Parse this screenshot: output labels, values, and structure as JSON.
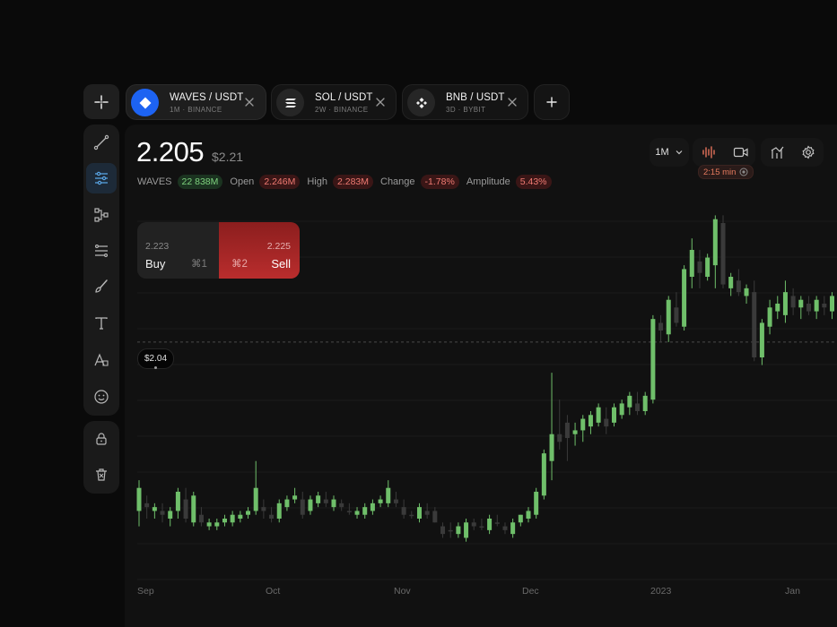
{
  "tabs": [
    {
      "pair": "WAVES / USDT",
      "meta": "1M · BINANCE",
      "active": true,
      "icon": "waves-diamond-icon"
    },
    {
      "pair": "SOL / USDT",
      "meta": "2W · BINANCE",
      "active": false,
      "icon": "solana-icon"
    },
    {
      "pair": "BNB / USDT",
      "meta": "3D · BYBIT",
      "active": false,
      "icon": "bnb-icon"
    }
  ],
  "header": {
    "price": "2.205",
    "price_usd": "$2.21"
  },
  "stats": {
    "symbol": "WAVES",
    "volume": "22 838M",
    "open_label": "Open",
    "open": "2.246M",
    "high_label": "High",
    "high": "2.283M",
    "change_label": "Change",
    "change": "-1.78%",
    "amplitude_label": "Amplitude",
    "amplitude": "5.43%"
  },
  "controls": {
    "timeframe": "1M",
    "recording_time": "2:15 min"
  },
  "trade": {
    "buy_price": "2.223",
    "buy_label": "Buy",
    "buy_shortcut": "⌘1",
    "sell_price": "2.225",
    "sell_label": "Sell",
    "sell_shortcut": "⌘2"
  },
  "price_tag": "$2.04",
  "colors": {
    "up": "#6fbf6a",
    "down": "#3a3a3a",
    "accent": "#1d63f2",
    "sell": "#b92d2d"
  },
  "chart_data": {
    "type": "candlestick",
    "x_labels": [
      "Sep",
      "Oct",
      "Nov",
      "Dec",
      "2023",
      "Jan"
    ],
    "candles": [
      {
        "o": 1.6,
        "h": 1.68,
        "l": 1.56,
        "c": 1.66,
        "up": true
      },
      {
        "o": 1.61,
        "h": 1.64,
        "l": 1.58,
        "c": 1.62,
        "up": false
      },
      {
        "o": 1.6,
        "h": 1.62,
        "l": 1.58,
        "c": 1.61,
        "up": true
      },
      {
        "o": 1.6,
        "h": 1.62,
        "l": 1.57,
        "c": 1.59,
        "up": false
      },
      {
        "o": 1.58,
        "h": 1.61,
        "l": 1.56,
        "c": 1.6,
        "up": true
      },
      {
        "o": 1.6,
        "h": 1.66,
        "l": 1.58,
        "c": 1.65,
        "up": true
      },
      {
        "o": 1.63,
        "h": 1.66,
        "l": 1.57,
        "c": 1.58,
        "up": false
      },
      {
        "o": 1.57,
        "h": 1.65,
        "l": 1.56,
        "c": 1.64,
        "up": true
      },
      {
        "o": 1.59,
        "h": 1.61,
        "l": 1.56,
        "c": 1.57,
        "up": false
      },
      {
        "o": 1.56,
        "h": 1.58,
        "l": 1.55,
        "c": 1.57,
        "up": true
      },
      {
        "o": 1.56,
        "h": 1.58,
        "l": 1.55,
        "c": 1.57,
        "up": true
      },
      {
        "o": 1.57,
        "h": 1.59,
        "l": 1.56,
        "c": 1.58,
        "up": true
      },
      {
        "o": 1.57,
        "h": 1.6,
        "l": 1.56,
        "c": 1.59,
        "up": true
      },
      {
        "o": 1.58,
        "h": 1.6,
        "l": 1.57,
        "c": 1.59,
        "up": true
      },
      {
        "o": 1.59,
        "h": 1.61,
        "l": 1.58,
        "c": 1.6,
        "up": true
      },
      {
        "o": 1.6,
        "h": 1.73,
        "l": 1.59,
        "c": 1.66,
        "up": true
      },
      {
        "o": 1.61,
        "h": 1.63,
        "l": 1.58,
        "c": 1.6,
        "up": false
      },
      {
        "o": 1.59,
        "h": 1.61,
        "l": 1.57,
        "c": 1.58,
        "up": false
      },
      {
        "o": 1.58,
        "h": 1.63,
        "l": 1.57,
        "c": 1.62,
        "up": true
      },
      {
        "o": 1.61,
        "h": 1.64,
        "l": 1.6,
        "c": 1.63,
        "up": true
      },
      {
        "o": 1.63,
        "h": 1.66,
        "l": 1.62,
        "c": 1.64,
        "up": true
      },
      {
        "o": 1.63,
        "h": 1.65,
        "l": 1.58,
        "c": 1.59,
        "up": false
      },
      {
        "o": 1.6,
        "h": 1.64,
        "l": 1.59,
        "c": 1.63,
        "up": true
      },
      {
        "o": 1.62,
        "h": 1.65,
        "l": 1.61,
        "c": 1.64,
        "up": true
      },
      {
        "o": 1.63,
        "h": 1.65,
        "l": 1.61,
        "c": 1.62,
        "up": false
      },
      {
        "o": 1.61,
        "h": 1.64,
        "l": 1.6,
        "c": 1.63,
        "up": true
      },
      {
        "o": 1.62,
        "h": 1.63,
        "l": 1.6,
        "c": 1.61,
        "up": false
      },
      {
        "o": 1.6,
        "h": 1.62,
        "l": 1.59,
        "c": 1.6,
        "up": false
      },
      {
        "o": 1.59,
        "h": 1.61,
        "l": 1.58,
        "c": 1.6,
        "up": true
      },
      {
        "o": 1.59,
        "h": 1.62,
        "l": 1.58,
        "c": 1.61,
        "up": true
      },
      {
        "o": 1.6,
        "h": 1.63,
        "l": 1.59,
        "c": 1.62,
        "up": true
      },
      {
        "o": 1.62,
        "h": 1.64,
        "l": 1.61,
        "c": 1.63,
        "up": true
      },
      {
        "o": 1.62,
        "h": 1.68,
        "l": 1.61,
        "c": 1.66,
        "up": true
      },
      {
        "o": 1.63,
        "h": 1.65,
        "l": 1.61,
        "c": 1.62,
        "up": false
      },
      {
        "o": 1.61,
        "h": 1.63,
        "l": 1.58,
        "c": 1.59,
        "up": false
      },
      {
        "o": 1.59,
        "h": 1.6,
        "l": 1.58,
        "c": 1.59,
        "up": false
      },
      {
        "o": 1.58,
        "h": 1.62,
        "l": 1.57,
        "c": 1.61,
        "up": true
      },
      {
        "o": 1.6,
        "h": 1.62,
        "l": 1.58,
        "c": 1.59,
        "up": false
      },
      {
        "o": 1.6,
        "h": 1.61,
        "l": 1.57,
        "c": 1.57,
        "up": false
      },
      {
        "o": 1.56,
        "h": 1.57,
        "l": 1.53,
        "c": 1.54,
        "up": false
      },
      {
        "o": 1.55,
        "h": 1.57,
        "l": 1.53,
        "c": 1.55,
        "up": false
      },
      {
        "o": 1.54,
        "h": 1.57,
        "l": 1.53,
        "c": 1.56,
        "up": true
      },
      {
        "o": 1.53,
        "h": 1.58,
        "l": 1.52,
        "c": 1.57,
        "up": true
      },
      {
        "o": 1.56,
        "h": 1.58,
        "l": 1.55,
        "c": 1.57,
        "up": false
      },
      {
        "o": 1.56,
        "h": 1.58,
        "l": 1.55,
        "c": 1.56,
        "up": false
      },
      {
        "o": 1.55,
        "h": 1.59,
        "l": 1.54,
        "c": 1.58,
        "up": true
      },
      {
        "o": 1.57,
        "h": 1.59,
        "l": 1.56,
        "c": 1.57,
        "up": false
      },
      {
        "o": 1.56,
        "h": 1.57,
        "l": 1.54,
        "c": 1.55,
        "up": false
      },
      {
        "o": 1.54,
        "h": 1.58,
        "l": 1.53,
        "c": 1.57,
        "up": true
      },
      {
        "o": 1.57,
        "h": 1.59,
        "l": 1.56,
        "c": 1.59,
        "up": true
      },
      {
        "o": 1.58,
        "h": 1.61,
        "l": 1.57,
        "c": 1.6,
        "up": true
      },
      {
        "o": 1.59,
        "h": 1.66,
        "l": 1.58,
        "c": 1.65,
        "up": true
      },
      {
        "o": 1.64,
        "h": 1.76,
        "l": 1.63,
        "c": 1.75,
        "up": true
      },
      {
        "o": 1.73,
        "h": 1.96,
        "l": 1.68,
        "c": 1.8,
        "up": true
      },
      {
        "o": 1.78,
        "h": 1.89,
        "l": 1.76,
        "c": 1.8,
        "up": false
      },
      {
        "o": 1.79,
        "h": 1.85,
        "l": 1.73,
        "c": 1.83,
        "up": false
      },
      {
        "o": 1.8,
        "h": 1.83,
        "l": 1.77,
        "c": 1.81,
        "up": true
      },
      {
        "o": 1.81,
        "h": 1.85,
        "l": 1.78,
        "c": 1.84,
        "up": true
      },
      {
        "o": 1.82,
        "h": 1.86,
        "l": 1.8,
        "c": 1.85,
        "up": true
      },
      {
        "o": 1.83,
        "h": 1.88,
        "l": 1.82,
        "c": 1.87,
        "up": true
      },
      {
        "o": 1.84,
        "h": 1.87,
        "l": 1.8,
        "c": 1.82,
        "up": false
      },
      {
        "o": 1.83,
        "h": 1.88,
        "l": 1.82,
        "c": 1.87,
        "up": true
      },
      {
        "o": 1.85,
        "h": 1.89,
        "l": 1.84,
        "c": 1.88,
        "up": true
      },
      {
        "o": 1.87,
        "h": 1.91,
        "l": 1.85,
        "c": 1.9,
        "up": true
      },
      {
        "o": 1.88,
        "h": 1.91,
        "l": 1.85,
        "c": 1.86,
        "up": false
      },
      {
        "o": 1.86,
        "h": 1.91,
        "l": 1.85,
        "c": 1.9,
        "up": true
      },
      {
        "o": 1.89,
        "h": 2.11,
        "l": 1.88,
        "c": 2.1,
        "up": true
      },
      {
        "o": 2.09,
        "h": 2.11,
        "l": 2.04,
        "c": 2.07,
        "up": false
      },
      {
        "o": 2.06,
        "h": 2.16,
        "l": 2.04,
        "c": 2.15,
        "up": true
      },
      {
        "o": 2.13,
        "h": 2.17,
        "l": 2.08,
        "c": 2.09,
        "up": false
      },
      {
        "o": 2.08,
        "h": 2.24,
        "l": 2.07,
        "c": 2.23,
        "up": true
      },
      {
        "o": 2.21,
        "h": 2.31,
        "l": 2.18,
        "c": 2.28,
        "up": true
      },
      {
        "o": 2.25,
        "h": 2.28,
        "l": 2.18,
        "c": 2.22,
        "up": false
      },
      {
        "o": 2.21,
        "h": 2.27,
        "l": 2.2,
        "c": 2.26,
        "up": true
      },
      {
        "o": 2.24,
        "h": 2.37,
        "l": 2.18,
        "c": 2.36,
        "up": true
      },
      {
        "o": 2.35,
        "h": 2.37,
        "l": 2.18,
        "c": 2.19,
        "up": false
      },
      {
        "o": 2.18,
        "h": 2.22,
        "l": 2.16,
        "c": 2.21,
        "up": true
      },
      {
        "o": 2.2,
        "h": 2.23,
        "l": 2.16,
        "c": 2.17,
        "up": false
      },
      {
        "o": 2.16,
        "h": 2.19,
        "l": 2.14,
        "c": 2.18,
        "up": true
      },
      {
        "o": 2.17,
        "h": 2.2,
        "l": 1.99,
        "c": 2.0,
        "up": false
      },
      {
        "o": 2.0,
        "h": 2.1,
        "l": 1.98,
        "c": 2.09,
        "up": true
      },
      {
        "o": 2.08,
        "h": 2.15,
        "l": 2.06,
        "c": 2.13,
        "up": true
      },
      {
        "o": 2.12,
        "h": 2.16,
        "l": 2.1,
        "c": 2.14,
        "up": true
      },
      {
        "o": 2.11,
        "h": 2.2,
        "l": 2.09,
        "c": 2.17,
        "up": true
      },
      {
        "o": 2.16,
        "h": 2.18,
        "l": 2.11,
        "c": 2.13,
        "up": false
      },
      {
        "o": 2.13,
        "h": 2.16,
        "l": 2.1,
        "c": 2.15,
        "up": true
      },
      {
        "o": 2.14,
        "h": 2.16,
        "l": 2.11,
        "c": 2.12,
        "up": false
      },
      {
        "o": 2.12,
        "h": 2.16,
        "l": 2.1,
        "c": 2.15,
        "up": true
      },
      {
        "o": 2.13,
        "h": 2.16,
        "l": 2.11,
        "c": 2.14,
        "up": false
      },
      {
        "o": 2.12,
        "h": 2.17,
        "l": 2.1,
        "c": 2.16,
        "up": true
      }
    ],
    "ylim": [
      1.44,
      2.42
    ],
    "reference_line": 2.04
  }
}
